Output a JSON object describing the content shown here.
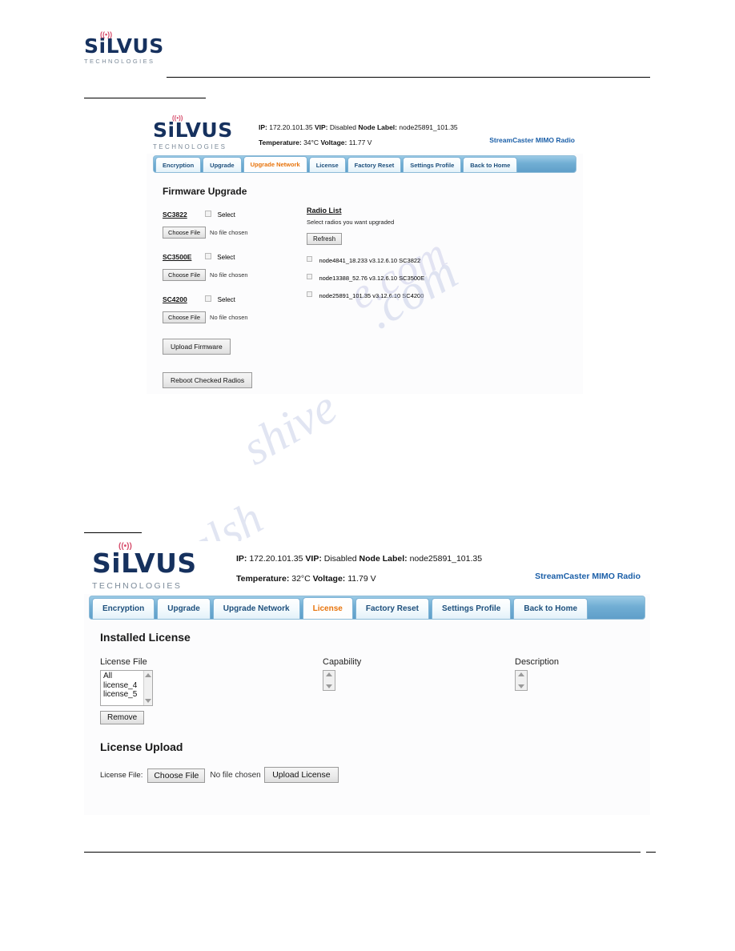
{
  "document": {
    "brand": {
      "name": "SiLVUS",
      "sub": "TECHNOLOGIES",
      "wave_left": "((",
      "wave_right": "))"
    },
    "watermarks": [
      "manualshive.com",
      "manuals"
    ]
  },
  "screenshot_upgrade_network": {
    "header": {
      "ip_label": "IP:",
      "ip_value": "172.20.101.35",
      "vip_label": "VIP:",
      "vip_value": "Disabled",
      "node_label_label": "Node Label:",
      "node_label_value": "node25891_101.35",
      "temperature_label": "Temperature:",
      "temperature_value": "34°C",
      "voltage_label": "Voltage:",
      "voltage_value": "11.77 V",
      "product": "StreamCaster MIMO Radio"
    },
    "tabs": [
      {
        "label": "Encryption",
        "active": false
      },
      {
        "label": "Upgrade",
        "active": false
      },
      {
        "label": "Upgrade Network",
        "active": true
      },
      {
        "label": "License",
        "active": false
      },
      {
        "label": "Factory Reset",
        "active": false
      },
      {
        "label": "Settings Profile",
        "active": false
      },
      {
        "label": "Back to Home",
        "active": false
      }
    ],
    "section_title": "Firmware Upgrade",
    "models": [
      {
        "name": "SC3822",
        "select_label": "Select",
        "choose_label": "Choose File",
        "file_status": "No file chosen"
      },
      {
        "name": "SC3500E",
        "select_label": "Select",
        "choose_label": "Choose File",
        "file_status": "No file chosen"
      },
      {
        "name": "SC4200",
        "select_label": "Select",
        "choose_label": "Choose File",
        "file_status": "No file chosen"
      }
    ],
    "upload_firmware_label": "Upload Firmware",
    "reboot_label": "Reboot Checked Radios",
    "radio_list": {
      "title": "Radio List",
      "hint": "Select radios you want upgraded",
      "refresh_label": "Refresh",
      "radios": [
        "node4841_18.233 v3.12.6.10 SC3822",
        "node13388_52.76 v3.12.6.10 SC3500E",
        "node25891_101.35 v3.12.6.10 SC4200"
      ]
    }
  },
  "screenshot_license": {
    "header": {
      "ip_label": "IP:",
      "ip_value": "172.20.101.35",
      "vip_label": "VIP:",
      "vip_value": "Disabled",
      "node_label_label": "Node Label:",
      "node_label_value": "node25891_101.35",
      "temperature_label": "Temperature:",
      "temperature_value": "32°C",
      "voltage_label": "Voltage:",
      "voltage_value": "11.79 V",
      "product": "StreamCaster MIMO Radio"
    },
    "tabs": [
      {
        "label": "Encryption",
        "active": false
      },
      {
        "label": "Upgrade",
        "active": false
      },
      {
        "label": "Upgrade Network",
        "active": false
      },
      {
        "label": "License",
        "active": true
      },
      {
        "label": "Factory Reset",
        "active": false
      },
      {
        "label": "Settings Profile",
        "active": false
      },
      {
        "label": "Back to Home",
        "active": false
      }
    ],
    "installed_title": "Installed License",
    "columns": {
      "license_file": "License File",
      "capability": "Capability",
      "description": "Description"
    },
    "license_files": [
      "All",
      "license_4",
      "license_5"
    ],
    "remove_label": "Remove",
    "upload_title": "License Upload",
    "license_file_label": "License File:",
    "choose_label": "Choose File",
    "file_status": "No file chosen",
    "upload_license_label": "Upload License"
  }
}
